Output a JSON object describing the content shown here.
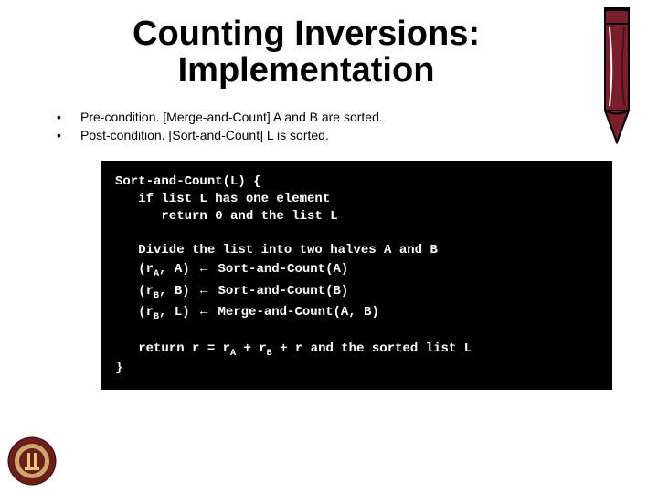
{
  "title_line1": "Counting Inversions:",
  "title_line2": "Implementation",
  "bullets": [
    {
      "prefix": "Pre-condition. ",
      "bracket": "[Merge-and-Count]",
      "suffix": "  A and B are sorted."
    },
    {
      "prefix": "Post-condition.  ",
      "bracket": "[Sort-and-Count]",
      "suffix": "  L is sorted."
    }
  ],
  "code": {
    "l1": "Sort-and-Count(L) {",
    "l2": "   if list L has one element",
    "l3": "      return 0 and the list L",
    "l4": "",
    "l5a": "   Divide the list into two halves A and B",
    "l6_pre": "   (r",
    "l6_sub": "A",
    "l6_mid": ", A) ",
    "l6_arrow": "←",
    "l6_post": " Sort-and-Count(A)",
    "l7_pre": "   (r",
    "l7_sub": "B",
    "l7_mid": ", B) ",
    "l7_arrow": "←",
    "l7_post": " Sort-and-Count(B)",
    "l8_pre": "   (r",
    "l8_sub": "B",
    "l8_mid": ", L) ",
    "l8_arrow": "←",
    "l8_post": " Merge-and-Count(A, B)",
    "l9": "",
    "l10_pre": "   return r = r",
    "l10_subA": "A",
    "l10_mid1": " + r",
    "l10_subB": "B",
    "l10_post": " + r and the sorted list L",
    "l11": "}"
  }
}
